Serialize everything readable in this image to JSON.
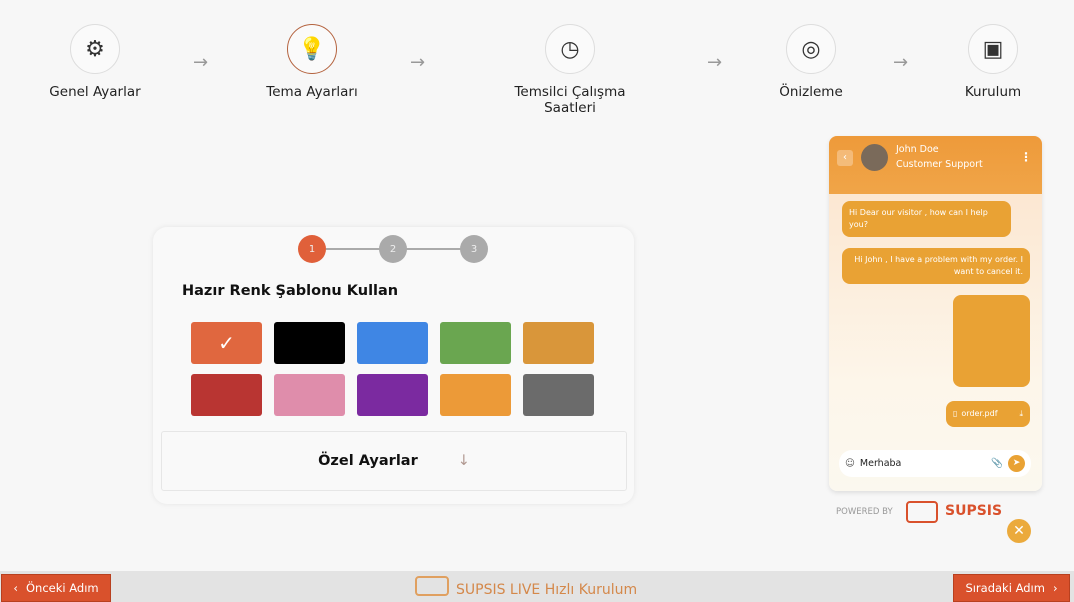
{
  "steps": [
    {
      "label": "Genel Ayarlar",
      "icon": "gears-icon"
    },
    {
      "label": "Tema Ayarları",
      "icon": "idea-hand-icon"
    },
    {
      "label": "Temsilci Çalışma Saatleri",
      "icon": "clock-icon"
    },
    {
      "label": "Önizleme",
      "icon": "target-icon"
    },
    {
      "label": "Kurulum",
      "icon": "install-icon"
    }
  ],
  "substeps": [
    "1",
    "2",
    "3"
  ],
  "theme": {
    "title": "Hazır Renk Şablonu Kullan",
    "swatches": [
      "#e0673f",
      "#000000",
      "#3f86e4",
      "#6aa650",
      "#d9963a",
      "#b93532",
      "#df8dab",
      "#7b2aa0",
      "#ec9a38",
      "#6b6b6b"
    ],
    "selected": 0,
    "custom_label": "Özel Ayarlar",
    "custom_arrow": "↓"
  },
  "chat": {
    "name": "John Doe",
    "role": "Customer Support",
    "msg1": "Hi Dear our visitor , how can I help you?",
    "msg2": "Hi John , I have a problem with my order. I want to cancel it.",
    "file": "order.pdf",
    "input": "Merhaba",
    "powered": "POWERED BY",
    "brand": "SUPSIS"
  },
  "footer": {
    "prev": "Önceki Adım",
    "next": "Sıradaki Adım",
    "title": "SUPSIS LIVE Hızlı Kurulum"
  }
}
